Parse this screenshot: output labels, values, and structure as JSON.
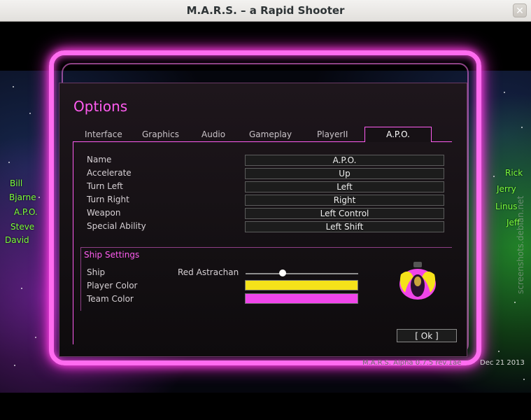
{
  "window": {
    "title": "M.A.R.S. – a Rapid Shooter",
    "close_label": "✕"
  },
  "options": {
    "title": "Options",
    "tabs": [
      "Interface",
      "Graphics",
      "Audio",
      "Gameplay",
      "PlayerII",
      "A.P.O."
    ],
    "active_tab": "A.P.O."
  },
  "bindings": [
    {
      "label": "Name",
      "value": "A.P.O."
    },
    {
      "label": "Accelerate",
      "value": "Up"
    },
    {
      "label": "Turn Left",
      "value": "Left"
    },
    {
      "label": "Turn Right",
      "value": "Right"
    },
    {
      "label": "Weapon",
      "value": "Left Control"
    },
    {
      "label": "Special Ability",
      "value": "Left Shift"
    }
  ],
  "ship_settings": {
    "title": "Ship Settings",
    "ship_label": "Ship",
    "ship_name": "Red Astrachan",
    "ship_slider_fraction": 0.33,
    "player_color_label": "Player Color",
    "player_color": "#f5e21a",
    "team_color_label": "Team Color",
    "team_color": "#f045ea"
  },
  "ok_label": "[ Ok ]",
  "players_left": [
    "Bill",
    "Bjarne",
    "A.P.O.",
    "Steve",
    "David"
  ],
  "players_right": [
    "Rick",
    "Jerry",
    "Linus",
    "Jeff"
  ],
  "version_text": "M.A.R.S. Alpha 0.7.5 rev.1ae",
  "date": "Dec 21 2013",
  "watermark": "screenshots.debian.net",
  "colors": {
    "neon_pink": "#ff6cf0",
    "player_green": "#7dff3c"
  }
}
